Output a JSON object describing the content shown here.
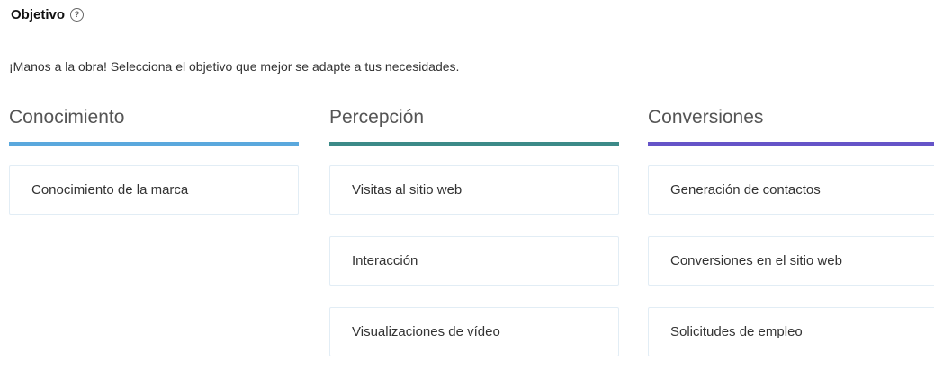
{
  "header": {
    "title": "Objetivo",
    "help_icon": "?"
  },
  "subtitle": "¡Manos a la obra! Selecciona el objetivo que mejor se adapte a tus necesidades.",
  "colors": {
    "conocimiento": "#5aa8dd",
    "percepcion": "#3c8a88",
    "conversiones": "#6554c8"
  },
  "columns": [
    {
      "heading": "Conocimiento",
      "options": [
        "Conocimiento de la marca"
      ]
    },
    {
      "heading": "Percepción",
      "options": [
        "Visitas al sitio web",
        "Interacción",
        "Visualizaciones de vídeo"
      ]
    },
    {
      "heading": "Conversiones",
      "options": [
        "Generación de contactos",
        "Conversiones en el sitio web",
        "Solicitudes de empleo"
      ]
    }
  ]
}
